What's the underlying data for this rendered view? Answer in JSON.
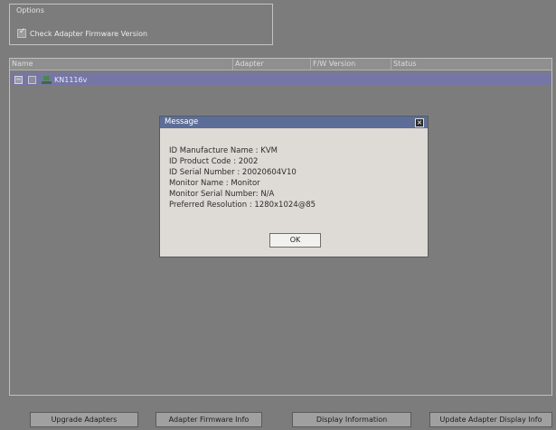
{
  "options": {
    "legend": "Options",
    "check_firmware_label": "Check Adapter Firmware Version",
    "check_firmware_checked": true
  },
  "list": {
    "columns": [
      "Name",
      "Adapter",
      "F/W Version",
      "Status"
    ],
    "rows": [
      {
        "label": "KN1116v",
        "expanded": true
      }
    ]
  },
  "dialog": {
    "title": "Message",
    "lines": [
      "ID Manufacture Name : KVM",
      "ID Product Code : 2002",
      "ID Serial Number : 20020604V10",
      "Monitor Name : Monitor",
      "Monitor Serial Number: N/A",
      "Preferred Resolution : 1280x1024@85"
    ],
    "ok_label": "OK"
  },
  "buttons": {
    "upgrade": "Upgrade Adapters",
    "firmware_info": "Adapter Firmware Info",
    "display_info": "Display Information",
    "update_display_info": "Update Adapter Display Info"
  },
  "colors": {
    "background": "#7c7c7c",
    "row_highlight": "#7676a6",
    "dialog_titlebar": "#5c6e98",
    "dialog_body": "#dedbd6"
  }
}
